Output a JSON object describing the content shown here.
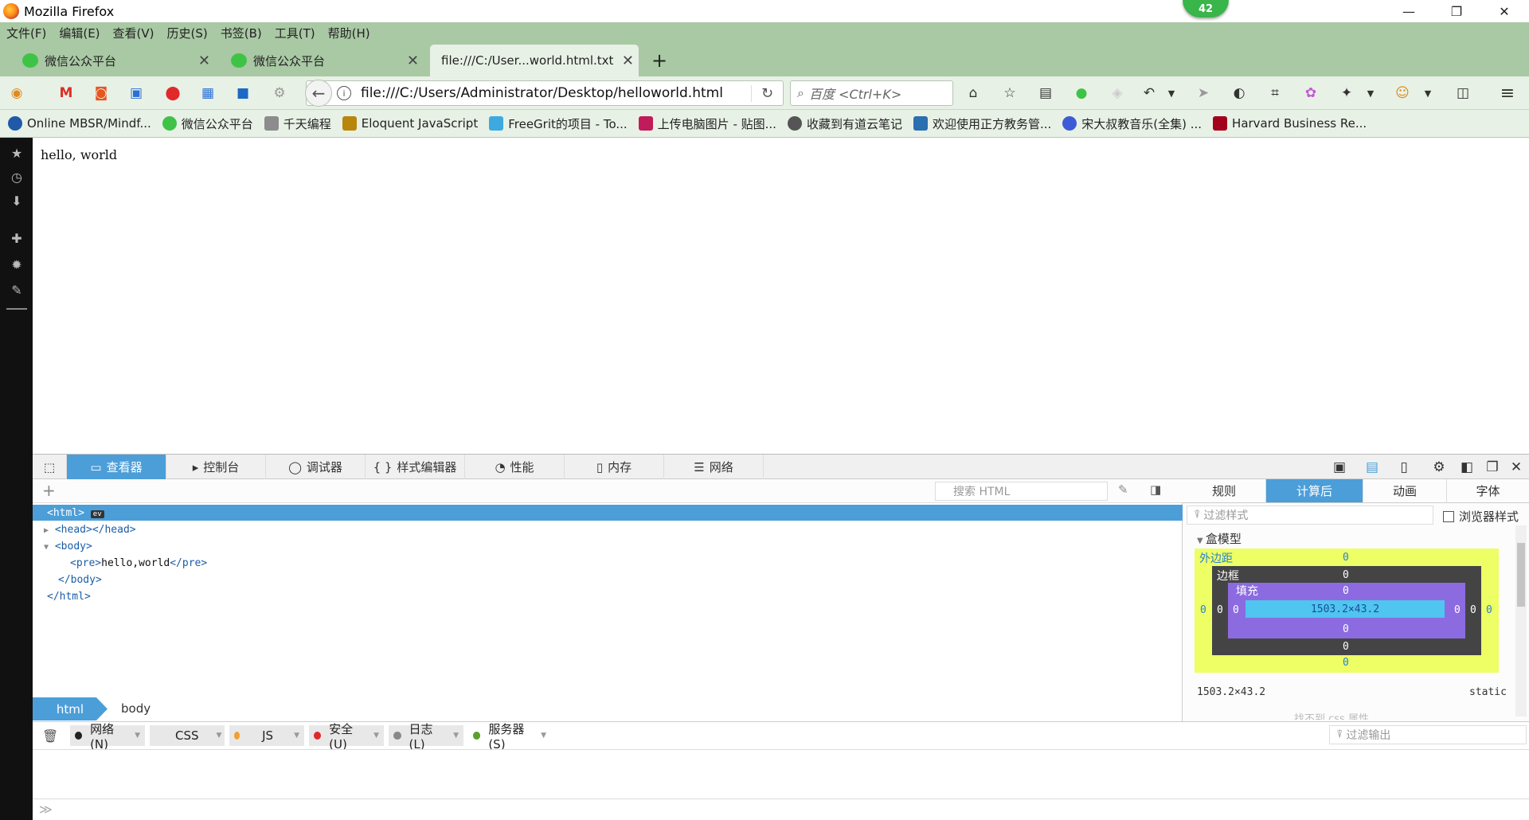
{
  "window": {
    "title": "Mozilla Firefox",
    "badge": "42",
    "min": "—",
    "max": "❐",
    "close": "✕"
  },
  "menu": [
    "文件(F)",
    "编辑(E)",
    "查看(V)",
    "历史(S)",
    "书签(B)",
    "工具(T)",
    "帮助(H)"
  ],
  "tabs": [
    {
      "label": "微信公众平台"
    },
    {
      "label": "微信公众平台"
    },
    {
      "label": "file:///C:/User...world.html.txt"
    }
  ],
  "newtab": "+",
  "nav": {
    "url": "file:///C:/Users/Administrator/Desktop/helloworld.html",
    "search_placeholder": "百度 <Ctrl+K>"
  },
  "bookmarks": [
    {
      "label": "Online MBSR/Mindf...",
      "color": "#1f5aa8"
    },
    {
      "label": "微信公众平台",
      "color": "#3ec347"
    },
    {
      "label": "千天编程",
      "color": "#8c8c8c"
    },
    {
      "label": "Eloquent JavaScript",
      "color": "#b8860b"
    },
    {
      "label": "FreeGrit的项目 - To...",
      "color": "#3ea9e0"
    },
    {
      "label": "上传电脑图片 - 贴图...",
      "color": "#c01b5a"
    },
    {
      "label": "收藏到有道云笔记",
      "color": "#555555"
    },
    {
      "label": "欢迎使用正方教务管...",
      "color": "#2a6fb0"
    },
    {
      "label": "宋大叔教音乐(全集) ...",
      "color": "#3d5bd6"
    },
    {
      "label": "Harvard Business Re...",
      "color": "#a3001b"
    }
  ],
  "page": {
    "text": "hello, world"
  },
  "devtools": {
    "tabs": [
      "查看器",
      "控制台",
      "调试器",
      "样式编辑器",
      "性能",
      "内存",
      "网络"
    ],
    "html_search_placeholder": "搜索 HTML",
    "markup": {
      "html_open": "<html>",
      "ev": "ev",
      "head": "<head></head>",
      "body_open": "<body>",
      "pre_open": "<pre>",
      "pre_text": "hello,world",
      "pre_close": "</pre>",
      "body_close": "</body>",
      "html_close": "</html>"
    },
    "breadcrumbs": [
      "html",
      "body"
    ],
    "right_tabs": [
      "规则",
      "计算后",
      "动画",
      "字体"
    ],
    "filter_placeholder": "过滤样式",
    "browser_styles": "浏览器样式",
    "box_model_heading": "盒模型",
    "box": {
      "margin_label": "外边距",
      "border_label": "边框",
      "padding_label": "填充",
      "zero": "0",
      "content": "1503.2×43.2"
    },
    "box_size": "1503.2×43.2",
    "position": "static",
    "cut_text": "找不到 css 属性"
  },
  "console": {
    "filters": [
      {
        "label": "网络(N)",
        "color": "#222222"
      },
      {
        "label": "CSS",
        "color": "#2ba7e0"
      },
      {
        "label": "JS",
        "color": "#f29e32"
      },
      {
        "label": "安全(U)",
        "color": "#e0282c"
      },
      {
        "label": "日志(L)",
        "color": "#888888"
      },
      {
        "label": "服务器(S)",
        "color": "#5aa02c"
      }
    ],
    "filter_output": "过滤输出",
    "prompt": "≫"
  }
}
